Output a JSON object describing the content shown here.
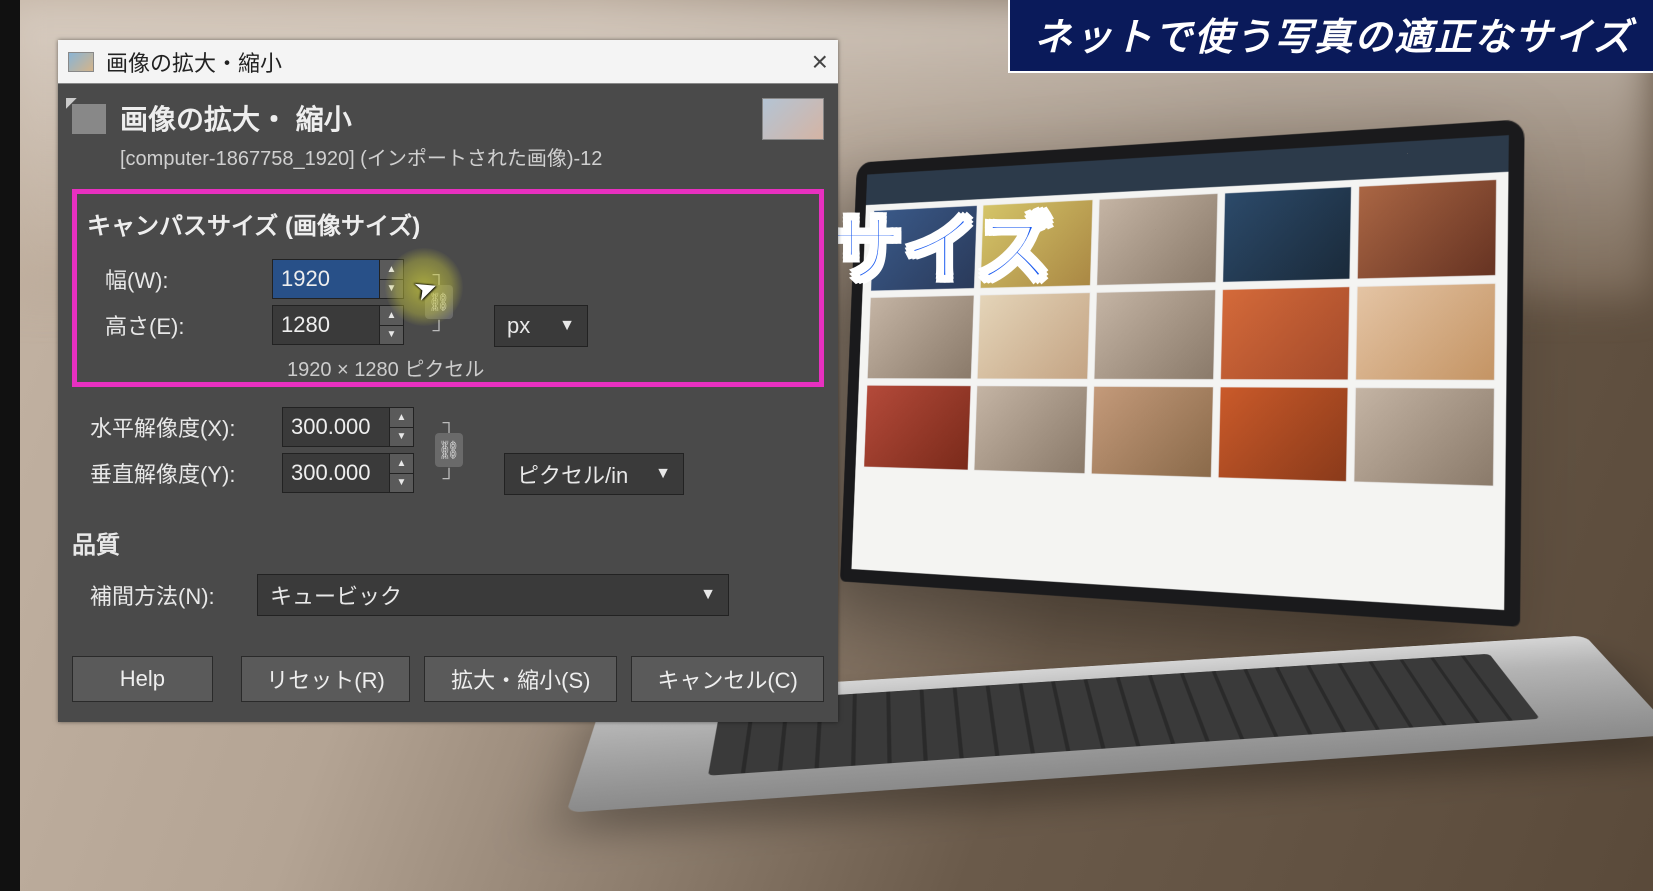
{
  "banner": {
    "title": "ネットで使う写真の適正なサイズ"
  },
  "overlay_caption": "写真のサイズ",
  "dialog": {
    "window_title": "画像の拡大・縮小",
    "header_title": "画像の拡大・ 縮小",
    "subtitle": "[computer-1867758_1920] (インポートされた画像)-12",
    "canvas_section": {
      "label": "キャンパスサイズ (画像サイズ)",
      "width_label": "幅(W):",
      "width_value": "1920",
      "height_label": "高さ(E):",
      "height_value": "1280",
      "unit": "px",
      "dimension_info": "1920 × 1280 ピクセル"
    },
    "resolution": {
      "x_label": "水平解像度(X):",
      "x_value": "300.000",
      "y_label": "垂直解像度(Y):",
      "y_value": "300.000",
      "unit": "ピクセル/in"
    },
    "quality": {
      "section_label": "品質",
      "interp_label": "補間方法(N):",
      "interp_value": "キュービック"
    },
    "buttons": {
      "help": "Help",
      "reset": "リセット(R)",
      "scale": "拡大・縮小(S)",
      "cancel": "キャンセル(C)"
    }
  }
}
